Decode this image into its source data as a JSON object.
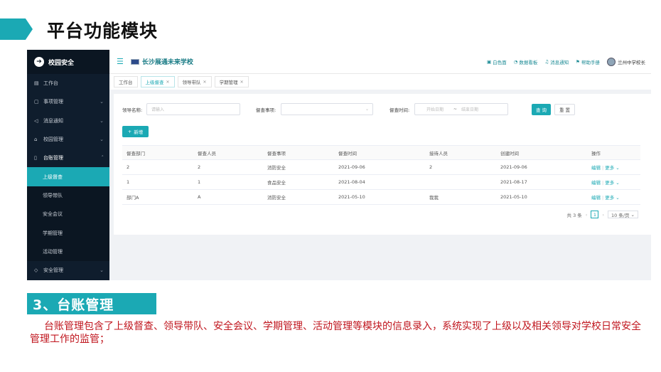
{
  "slide": {
    "title": "平台功能模块",
    "section_title": "3、台账管理",
    "description": "台账管理包含了上级督查、领导带队、安全会议、学期管理、活动管理等模块的信息录入，系统实现了上级以及相关领导对学校日常安全管理工作的监管；"
  },
  "app": {
    "brand": "校园安全",
    "school_name": "长沙展通未来学校",
    "top_actions": {
      "whiteboard": "白色面",
      "dashboard": "数据看板",
      "notify": "消息通知",
      "help": "帮助手册",
      "user": "兰州中学校长"
    },
    "sidebar": {
      "items": [
        {
          "label": "工作台",
          "icon": "grid-icon"
        },
        {
          "label": "事项管理",
          "icon": "calendar-icon"
        },
        {
          "label": "消息通知",
          "icon": "megaphone-icon"
        },
        {
          "label": "校园管理",
          "icon": "home-icon"
        },
        {
          "label": "台账管理",
          "icon": "document-icon"
        }
      ],
      "sub_items": [
        "上级督查",
        "领导带队",
        "安全会议",
        "学期管理",
        "活动管理"
      ],
      "last_item": {
        "label": "安全管理",
        "icon": "shield-icon"
      }
    },
    "tabs": [
      {
        "label": "工作台"
      },
      {
        "label": "上级督查"
      },
      {
        "label": "领导带队"
      },
      {
        "label": "学期管理"
      }
    ],
    "filters": {
      "leader_label": "领导名称:",
      "leader_placeholder": "请输入",
      "item_label": "督查事项:",
      "time_label": "督查时间:",
      "start_placeholder": "开始日期",
      "range_sep": "~",
      "end_placeholder": "结束日期",
      "query_button": "查 询",
      "reset_button": "重 置"
    },
    "new_button": "新增",
    "table": {
      "headers": [
        "督查部门",
        "督查人员",
        "督查事项",
        "督查时间",
        "接待人员",
        "创建时间",
        "操作"
      ],
      "rows": [
        [
          "2",
          "2",
          "消防安全",
          "2021-09-06",
          "2",
          "2021-09-06"
        ],
        [
          "1",
          "1",
          "食品安全",
          "2021-08-04",
          "",
          "2021-08-17"
        ],
        [
          "部门A",
          "A",
          "消防安全",
          "2021-05-10",
          "我我",
          "2021-05-10"
        ]
      ],
      "op_edit": "编辑",
      "op_more": "更多"
    },
    "pager": {
      "total": "共 3 条",
      "page": "1",
      "size": "10 条/页"
    },
    "colors": {
      "accent": "#1ba9b4",
      "sidebar_bg": "#0f1d2d",
      "desc_text": "#c0161e"
    }
  }
}
